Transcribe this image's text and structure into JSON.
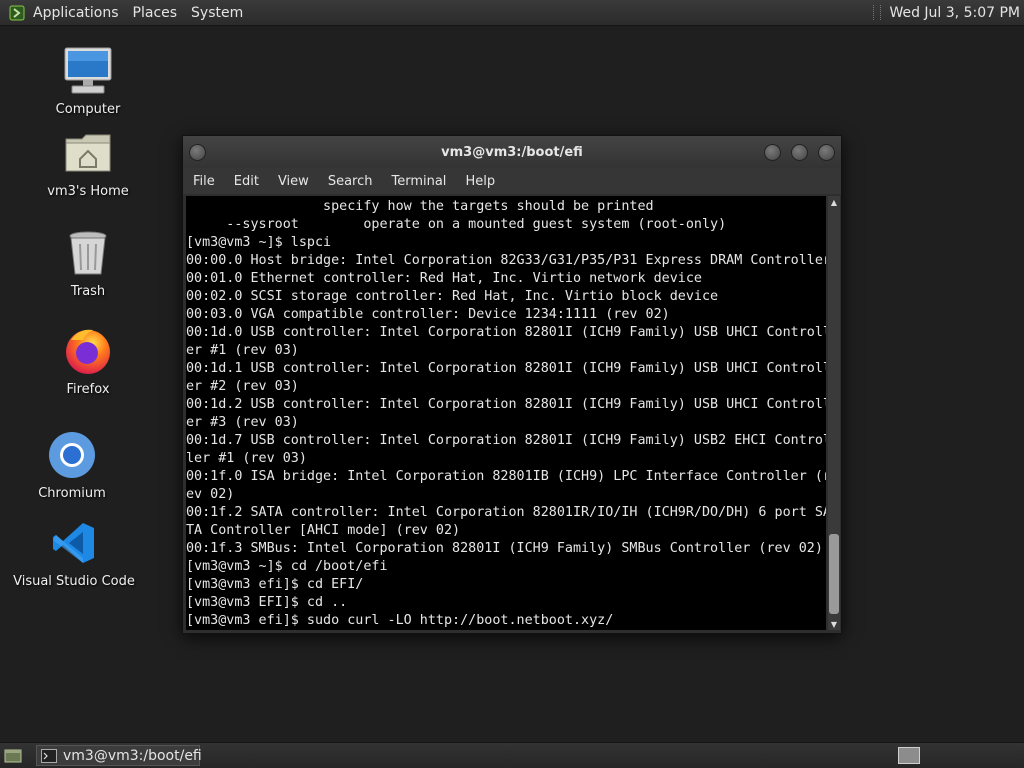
{
  "top_panel": {
    "menus": [
      "Applications",
      "Places",
      "System"
    ],
    "clock": "Wed Jul  3,  5:07 PM"
  },
  "desktop": {
    "icons": [
      {
        "label": "Computer",
        "icon": "computer-icon"
      },
      {
        "label": "vm3's Home",
        "icon": "home-folder-icon"
      },
      {
        "label": "Trash",
        "icon": "trash-icon"
      },
      {
        "label": "Firefox",
        "icon": "firefox-icon"
      },
      {
        "label": "Chromium",
        "icon": "chromium-icon"
      },
      {
        "label": "Visual Studio Code",
        "icon": "vscode-icon"
      }
    ]
  },
  "terminal": {
    "title": "vm3@vm3:/boot/efi",
    "menu": [
      "File",
      "Edit",
      "View",
      "Search",
      "Terminal",
      "Help"
    ],
    "lines": [
      "                 specify how the targets should be printed",
      "     --sysroot        operate on a mounted guest system (root-only)",
      "[vm3@vm3 ~]$ lspci",
      "00:00.0 Host bridge: Intel Corporation 82G33/G31/P35/P31 Express DRAM Controller",
      "00:01.0 Ethernet controller: Red Hat, Inc. Virtio network device",
      "00:02.0 SCSI storage controller: Red Hat, Inc. Virtio block device",
      "00:03.0 VGA compatible controller: Device 1234:1111 (rev 02)",
      "00:1d.0 USB controller: Intel Corporation 82801I (ICH9 Family) USB UHCI Controll",
      "er #1 (rev 03)",
      "00:1d.1 USB controller: Intel Corporation 82801I (ICH9 Family) USB UHCI Controll",
      "er #2 (rev 03)",
      "00:1d.2 USB controller: Intel Corporation 82801I (ICH9 Family) USB UHCI Controll",
      "er #3 (rev 03)",
      "00:1d.7 USB controller: Intel Corporation 82801I (ICH9 Family) USB2 EHCI Control",
      "ler #1 (rev 03)",
      "00:1f.0 ISA bridge: Intel Corporation 82801IB (ICH9) LPC Interface Controller (r",
      "ev 02)",
      "00:1f.2 SATA controller: Intel Corporation 82801IR/IO/IH (ICH9R/DO/DH) 6 port SA",
      "TA Controller [AHCI mode] (rev 02)",
      "00:1f.3 SMBus: Intel Corporation 82801I (ICH9 Family) SMBus Controller (rev 02)",
      "[vm3@vm3 ~]$ cd /boot/efi",
      "[vm3@vm3 efi]$ cd EFI/",
      "[vm3@vm3 EFI]$ cd ..",
      "[vm3@vm3 efi]$ sudo curl -LO http://boot.netboot.xyz/"
    ]
  },
  "taskbar": {
    "window_button": "vm3@vm3:/boot/efi"
  }
}
